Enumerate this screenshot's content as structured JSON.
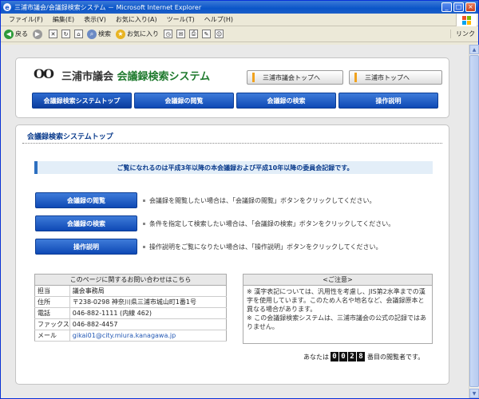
{
  "window": {
    "title": "三浦市議会/会議録検索システム － Microsoft Internet Explorer",
    "min": "_",
    "max": "□",
    "close": "×"
  },
  "menubar": {
    "items": [
      "ファイル(F)",
      "編集(E)",
      "表示(V)",
      "お気に入り(A)",
      "ツール(T)",
      "ヘルプ(H)"
    ]
  },
  "toolbar": {
    "back_label": "戻る",
    "search_label": "検索",
    "favorites_label": "お気に入り",
    "links_label": "リンク"
  },
  "header": {
    "logo": "OO",
    "title_part1": "三浦市議会",
    "title_part2": "会議録検索システム",
    "links": [
      "三浦市議会トップへ",
      "三浦市トップへ"
    ],
    "nav": [
      "会議録検索システムトップ",
      "会議録の閲覧",
      "会議録の検索",
      "操作説明"
    ]
  },
  "main": {
    "title": "会議録検索システムトップ",
    "notice": "ご覧になれるのは平成3年以降の本会議録および平成10年以降の委員会記録です。",
    "actions": [
      {
        "button": "会議録の閲覧",
        "desc": "会議録を閲覧したい場合は、「会議録の閲覧」ボタンをクリックしてください。"
      },
      {
        "button": "会議録の検索",
        "desc": "条件を指定して検索したい場合は、「会議録の検索」ボタンをクリックしてください。"
      },
      {
        "button": "操作説明",
        "desc": "操作説明をご覧になりたい場合は、「操作説明」ボタンをクリックしてください。"
      }
    ],
    "contact": {
      "heading": "このページに関するお問い合わせはこちら",
      "rows": [
        {
          "key": "担当",
          "value": "議会事務局"
        },
        {
          "key": "住所",
          "value": "〒238-0298 神奈川県三浦市城山町1番1号"
        },
        {
          "key": "電話",
          "value": "046-882-1111 (内線 462)"
        },
        {
          "key": "ファックス",
          "value": "046-882-4457"
        },
        {
          "key": "メール",
          "value": "gikai01@city.miura.kanagawa.jp"
        }
      ]
    },
    "caution": {
      "heading": "<ご注意>",
      "line1": "※ 漢字表記については、汎用性を考慮し、JIS第2水準までの漢字を使用しています。このため人名や地名など、会議録原本と異なる場合があります。",
      "line2": "※ この会議録検索システムは、三浦市議会の公式の記録ではありません。"
    },
    "visitor": {
      "prefix": "あなたは",
      "digits": [
        "0",
        "0",
        "2",
        "8"
      ],
      "suffix": "番目の閲覧者です。"
    }
  }
}
